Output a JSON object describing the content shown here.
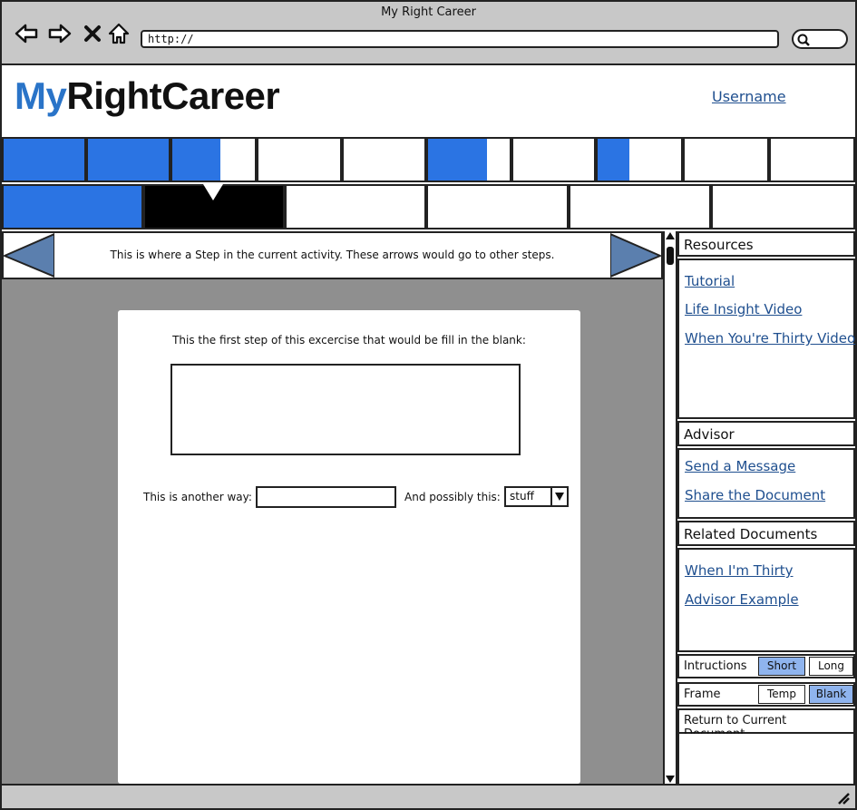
{
  "window": {
    "title": "My Right Career"
  },
  "browser": {
    "url": "http://"
  },
  "header": {
    "logo_my": "My",
    "logo_rest": "RightCareer",
    "username": "Username"
  },
  "tabs_row1": [
    {
      "fill": 1.0
    },
    {
      "fill": 1.0
    },
    {
      "fill": 0.58
    },
    {
      "fill": 0
    },
    {
      "fill": 0
    },
    {
      "fill": 0.72
    },
    {
      "fill": 0
    },
    {
      "fill": 0.38
    },
    {
      "fill": 0
    },
    {
      "fill": 0
    }
  ],
  "tabs_row2": [
    {
      "state": "complete"
    },
    {
      "state": "current"
    },
    {
      "state": "empty"
    },
    {
      "state": "empty"
    },
    {
      "state": "empty"
    },
    {
      "state": "empty"
    }
  ],
  "step": {
    "text": "This is where a Step in the current activity. These arrows would go to other steps."
  },
  "card": {
    "prompt": "This the first step of this excercise that would be fill in the blank:",
    "another_label": "This is another way:",
    "possibly_label": "And possibly this:",
    "select_value": "stuff"
  },
  "sidebar": {
    "resources": {
      "title": "Resources",
      "links": [
        "Tutorial",
        "Life Insight Video",
        "When You're Thirty Video"
      ]
    },
    "advisor": {
      "title": "Advisor",
      "links": [
        "Send a Message",
        "Share the Document"
      ]
    },
    "related": {
      "title": "Related Documents",
      "links": [
        "When I'm Thirty",
        "Advisor Example"
      ]
    },
    "instructions": {
      "label": "Intructions",
      "short": "Short",
      "long": "Long",
      "selected": "Short"
    },
    "frame": {
      "label": "Frame",
      "temp": "Temp",
      "blank": "Blank",
      "selected": "Blank"
    },
    "return_label": "Return to Current Document"
  },
  "colors": {
    "accent": "#2b74e3",
    "logo_blue": "#2a74c8",
    "link": "#1f4f8f",
    "arrow": "#5b7fae",
    "toggle_on": "#8fb4ee"
  }
}
